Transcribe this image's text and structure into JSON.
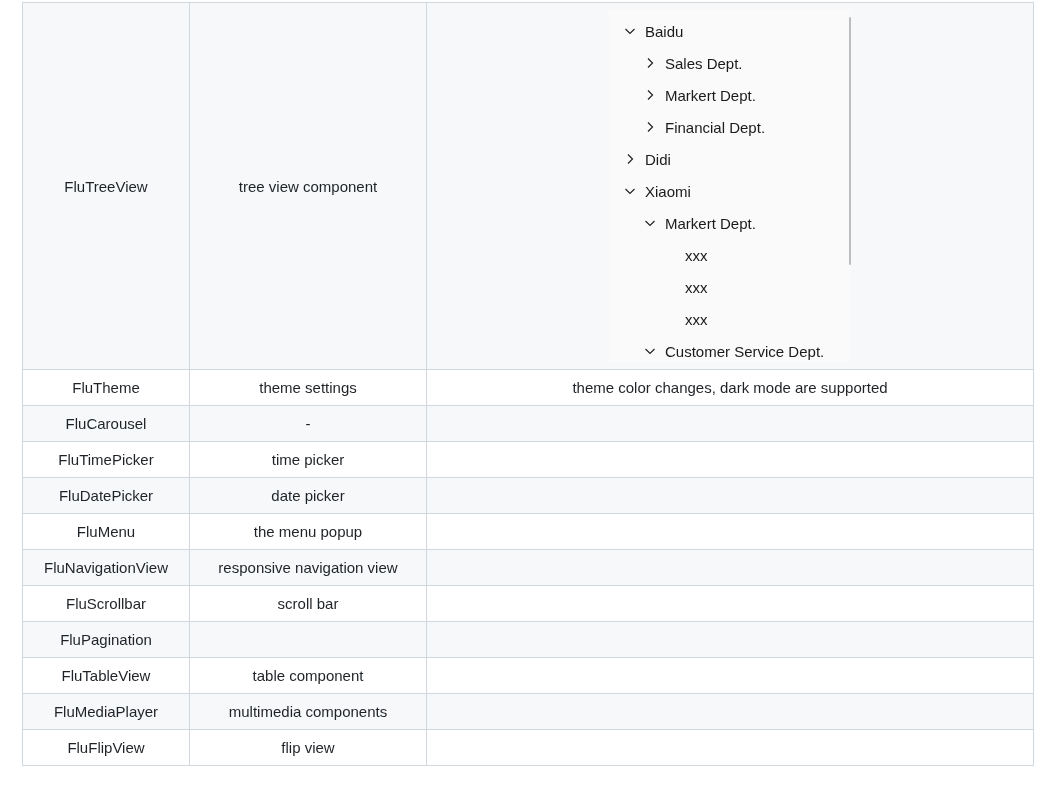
{
  "table": {
    "rows": [
      {
        "component": "FluTreeView",
        "description": "tree view component",
        "demo": {
          "kind": "tree",
          "items": [
            {
              "label": "Baidu",
              "expanded": true,
              "children": [
                {
                  "label": "Sales Dept.",
                  "expanded": false
                },
                {
                  "label": "Markert Dept.",
                  "expanded": false
                },
                {
                  "label": "Financial Dept.",
                  "expanded": false
                }
              ]
            },
            {
              "label": "Didi",
              "expanded": false
            },
            {
              "label": "Xiaomi",
              "expanded": true,
              "children": [
                {
                  "label": "Markert Dept.",
                  "expanded": true,
                  "children": [
                    {
                      "label": "xxx"
                    },
                    {
                      "label": "xxx"
                    },
                    {
                      "label": "xxx"
                    }
                  ]
                },
                {
                  "label": "Customer Service Dept.",
                  "expanded": true
                }
              ]
            }
          ]
        }
      },
      {
        "component": "FluTheme",
        "description": "theme settings",
        "demo": {
          "kind": "text",
          "text": "theme color changes, dark mode are supported"
        }
      },
      {
        "component": "FluCarousel",
        "description": "-"
      },
      {
        "component": "FluTimePicker",
        "description": "time picker"
      },
      {
        "component": "FluDatePicker",
        "description": "date picker"
      },
      {
        "component": "FluMenu",
        "description": "the menu popup"
      },
      {
        "component": "FluNavigationView",
        "description": "responsive navigation view"
      },
      {
        "component": "FluScrollbar",
        "description": "scroll bar"
      },
      {
        "component": "FluPagination"
      },
      {
        "component": "FluTableView",
        "description": "table component"
      },
      {
        "component": "FluMediaPlayer",
        "description": "multimedia components"
      },
      {
        "component": "FluFlipView",
        "description": "flip view"
      }
    ]
  }
}
